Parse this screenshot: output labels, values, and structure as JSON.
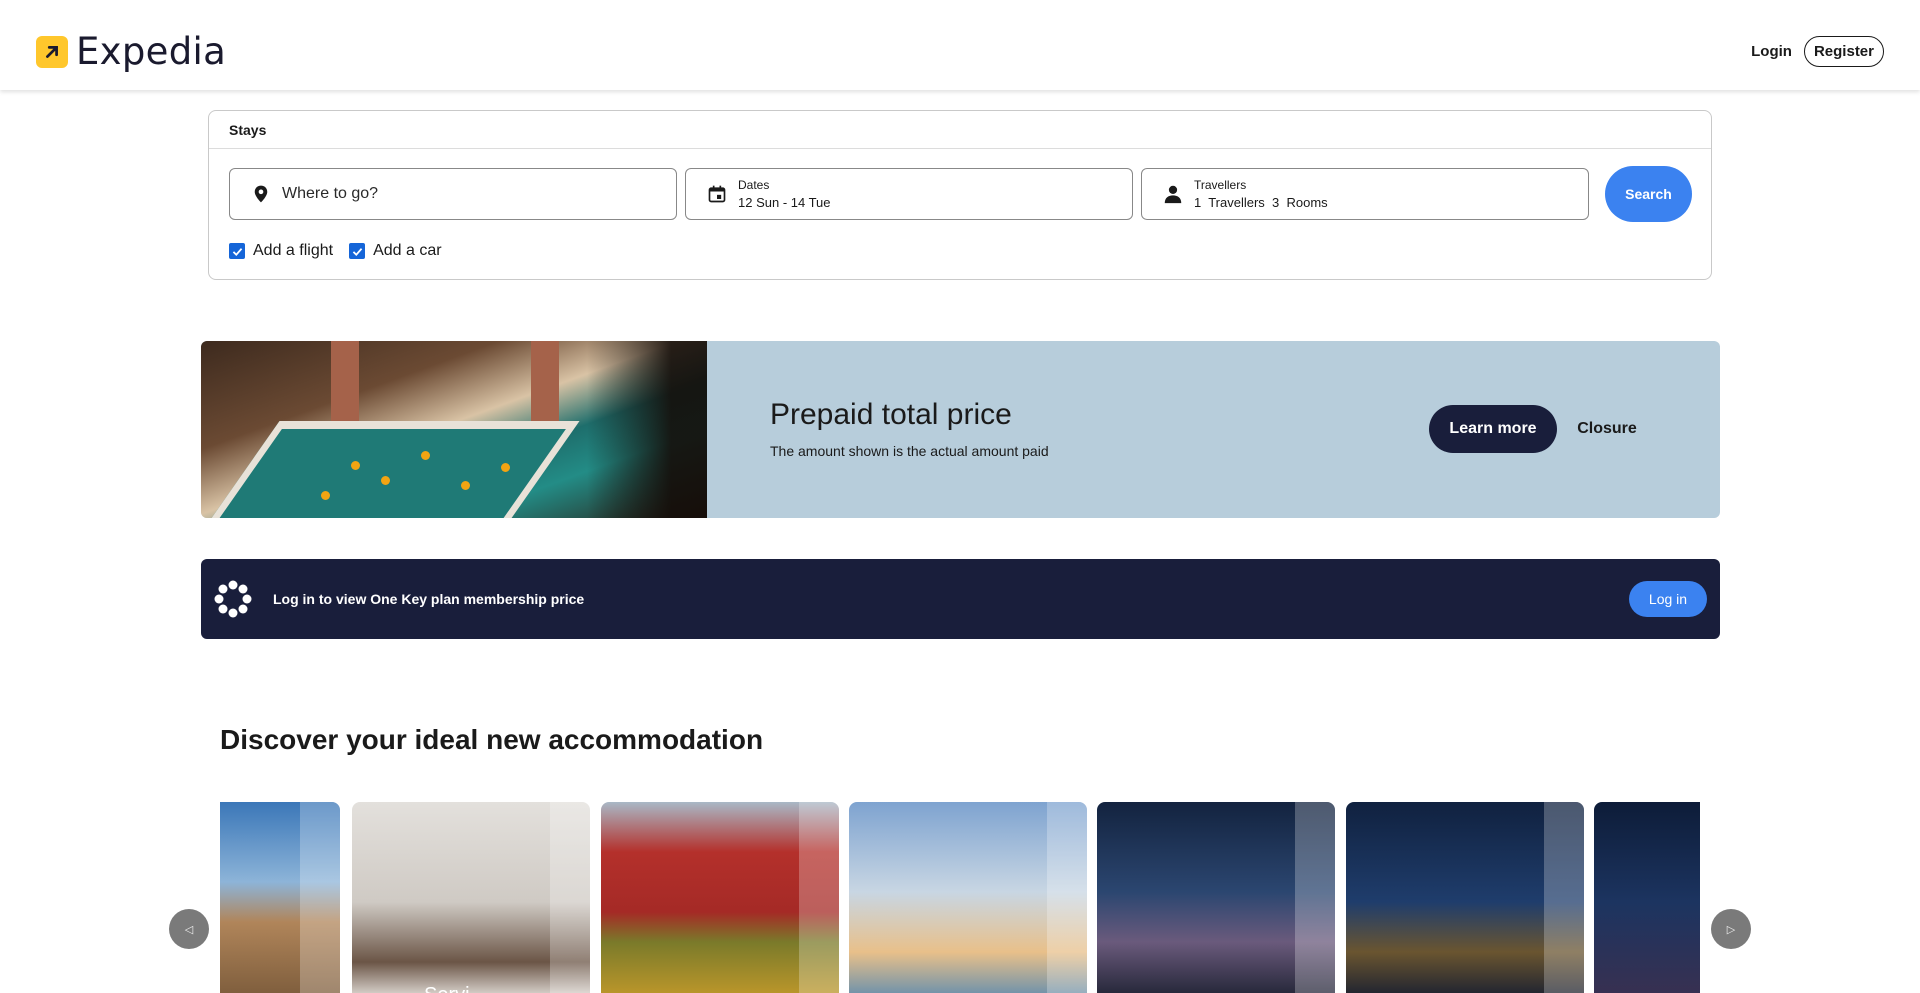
{
  "header": {
    "brand": "Expedia",
    "login_label": "Login",
    "register_label": "Register"
  },
  "search": {
    "tab_label": "Stays",
    "destination_placeholder": "Where to go?",
    "dates_label": "Dates",
    "dates_value": "12 Sun - 14 Tue",
    "travellers_label": "Travellers",
    "travellers_value": "1  Travellers  3  Rooms",
    "search_label": "Search",
    "add_flight_label": "Add a flight",
    "add_car_label": "Add a car",
    "add_flight_checked": true,
    "add_car_checked": true
  },
  "promo": {
    "title": "Prepaid total price",
    "subtitle": "The amount shown is the actual amount paid",
    "learn_more_label": "Learn more",
    "closure_label": "Closure"
  },
  "onekey": {
    "text": "Log in to view One Key plan membership price",
    "button_label": "Log in"
  },
  "discover": {
    "title": "Discover your ideal new accommodation",
    "cards": [
      {
        "name": "castle"
      },
      {
        "name": "hotel-room",
        "label": "Servi..."
      },
      {
        "name": "red-barn"
      },
      {
        "name": "water-park"
      },
      {
        "name": "dubai-skyline"
      },
      {
        "name": "kuala-lumpur-skyline"
      },
      {
        "name": "city-night"
      }
    ]
  },
  "icons": {
    "destination": "map-pin-icon",
    "dates": "calendar-icon",
    "travellers": "person-icon",
    "onekey": "onekey-dots-icon",
    "carousel_left": "chevron-left-icon",
    "carousel_right": "chevron-right-icon"
  },
  "colors": {
    "brand_yellow": "#ffc72c",
    "search_blue": "#3b82f0",
    "navy": "#191e3b",
    "promo_bg": "#b7cddb"
  }
}
